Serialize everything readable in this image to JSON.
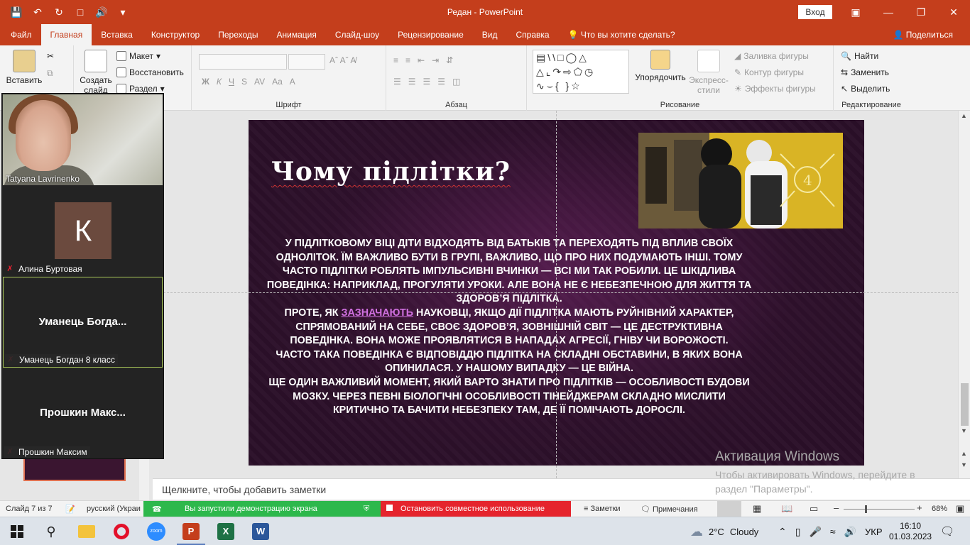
{
  "window": {
    "title": "Редан  -  PowerPoint",
    "login_label": "Вход"
  },
  "tabs": [
    "Файл",
    "Главная",
    "Вставка",
    "Конструктор",
    "Переходы",
    "Анимация",
    "Слайд-шоу",
    "Рецензирование",
    "Вид",
    "Справка"
  ],
  "tell_me": "Что вы хотите сделать?",
  "share_label": "Поделиться",
  "ribbon": {
    "paste": "Вставить",
    "create_slide": "Создать слайд",
    "layout": "Макет",
    "reset": "Восстановить",
    "section": "Раздел",
    "font_group": "Шрифт",
    "paragraph_group": "Абзац",
    "drawing_group": "Рисование",
    "editing_group": "Редактирование",
    "arrange": "Упорядочить",
    "quick_styles": "Экспресс-стили",
    "shape_fill": "Заливка фигуры",
    "shape_outline": "Контур фигуры",
    "shape_effects": "Эффекты фигуры",
    "find": "Найти",
    "replace": "Заменить",
    "select": "Выделить"
  },
  "zoom_panel": {
    "video_name": "Tatyana Lavrinenko",
    "p2_initial": "К",
    "p2_label": "Алина Буртовая",
    "p3_center": "Уманець  Богда...",
    "p3_label": "Уманець Богдан 8 класс",
    "p4_center": "Прошкин  Макс...",
    "p4_label": "Прошкин Максим"
  },
  "slide": {
    "title": "Чому підлітки?",
    "paragraphs": [
      "У підлітковому віці діти відходять від батьків та переходять під вплив своїх одноліток. Їм важливо бути в групі, важливо, що про них подумають інші. Тому часто підлітки роблять імпульсивні вчинки — всі ми так робили. Це шкідлива поведінка: наприклад, прогуляти уроки. Але вона не є небезпечною для життя та здоров’я підлітка.",
      "Часто така поведінка є відповіддю підлітка на складні обставини, в яких вона опинилася. У нашому випадку — це війна.",
      "Ще один важливий момент, який варто знати про підлітків — особливості будови мозку. Через певні біологічні особливості тінейджерам складно мислити критично та бачити небезпеку там, де її помічають дорослі."
    ],
    "p2_before": "Проте, як ",
    "p2_link": "зазначають",
    "p2_after": " науковці, якщо дії підлітка мають руйнівний характер, спрямований на себе, своє здоров’я, зовнішній світ — це деструктивна поведінка. Вона може проявлятися в нападах агресії, гніву чи ворожості."
  },
  "notes_placeholder": "Щелкните, чтобы добавить заметки",
  "activation": {
    "title": "Активация Windows",
    "line1": "Чтобы активировать Windows, перейдите в",
    "line2": "раздел \"Параметры\"."
  },
  "status": {
    "slide_of": "Слайд 7 из 7",
    "language": "русский (Украи",
    "sharing": "Вы запустили демонстрацию экрана",
    "stop_share": "Остановить совместное использование",
    "notes": "Заметки",
    "comments": "Примечания",
    "zoom_level": "68%"
  },
  "taskbar": {
    "weather_temp": "2°C",
    "weather_desc": "Cloudy",
    "lang": "УКР",
    "time": "16:10",
    "date": "01.03.2023"
  },
  "colors": {
    "accent": "#c43e1c",
    "share_green": "#2db84c",
    "share_red": "#e5242d",
    "link": "#d070e0"
  }
}
